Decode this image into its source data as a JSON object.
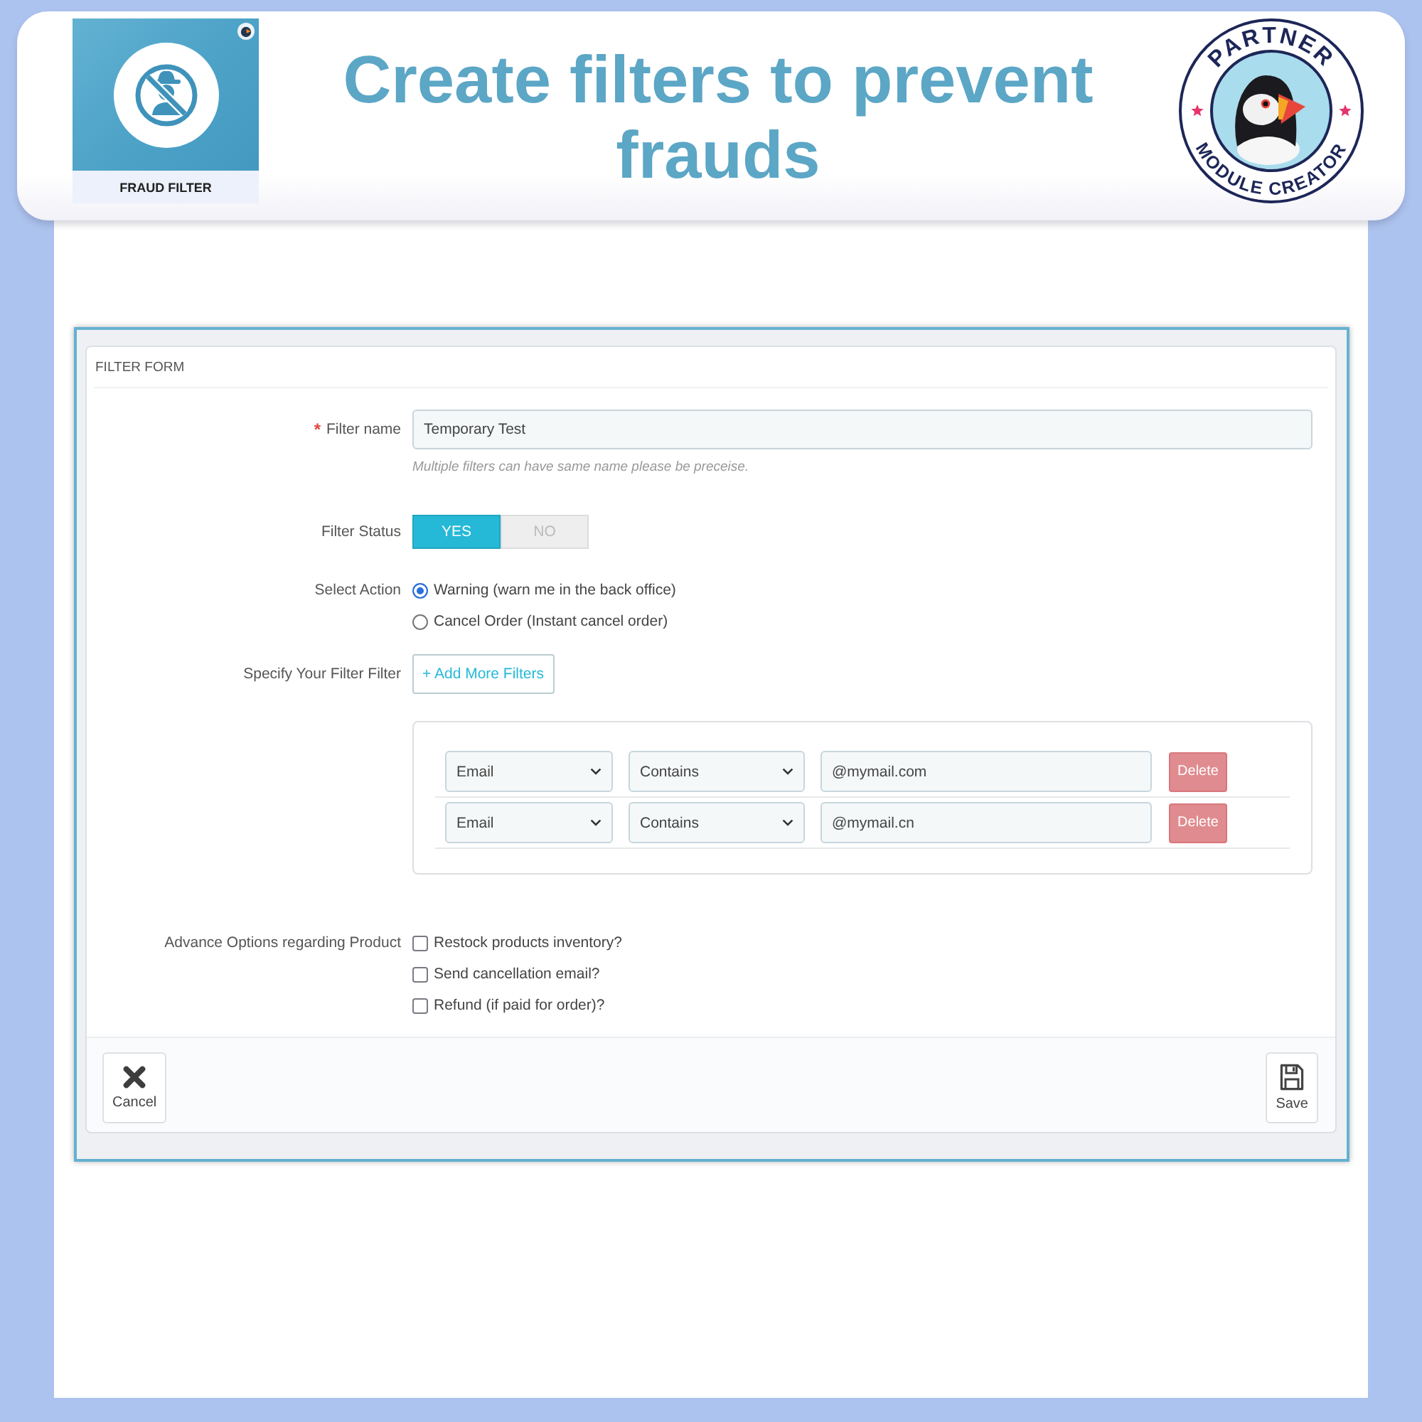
{
  "header": {
    "product_tile": {
      "label": "FRAUD FILTER"
    },
    "title": "Create filters to prevent frauds",
    "badge": {
      "top_text": "PARTNER",
      "bottom_text": "MODULE CREATOR"
    }
  },
  "panel": {
    "title": "FILTER FORM",
    "rows": [
      {
        "kind": "text",
        "required_mark": "*",
        "label": "Filter name",
        "value": "Temporary Test",
        "help": "Multiple filters can have same name please be preceise."
      },
      {
        "kind": "switch",
        "label": "Filter Status",
        "options": [
          {
            "label": "YES",
            "selected": true
          },
          {
            "label": "NO",
            "selected": false
          }
        ]
      },
      {
        "kind": "radio",
        "label": "Select Action",
        "options": [
          {
            "label": "Warning (warn me in the back office)",
            "selected": true
          },
          {
            "label": "Cancel Order (Instant cancel order)",
            "selected": false
          }
        ]
      },
      {
        "kind": "button",
        "label": "Specify Your Filter Filter",
        "button": "+ Add More Filters"
      },
      {
        "kind": "filters",
        "filters": [
          {
            "field": "Email",
            "operator": "Contains",
            "value": "@mymail.com",
            "action": "Delete"
          },
          {
            "field": "Email",
            "operator": "Contains",
            "value": "@mymail.cn",
            "action": "Delete"
          }
        ]
      },
      {
        "kind": "checkbox",
        "label": "Advance Options regarding Product",
        "options": [
          {
            "label": "Restock products inventory?",
            "checked": false
          },
          {
            "label": "Send cancellation email?",
            "checked": false
          },
          {
            "label": "Refund (if paid for order)?",
            "checked": false
          }
        ]
      }
    ],
    "footer_buttons": [
      {
        "kind": "cancel",
        "label": "Cancel"
      },
      {
        "kind": "save",
        "label": "Save"
      }
    ]
  }
}
